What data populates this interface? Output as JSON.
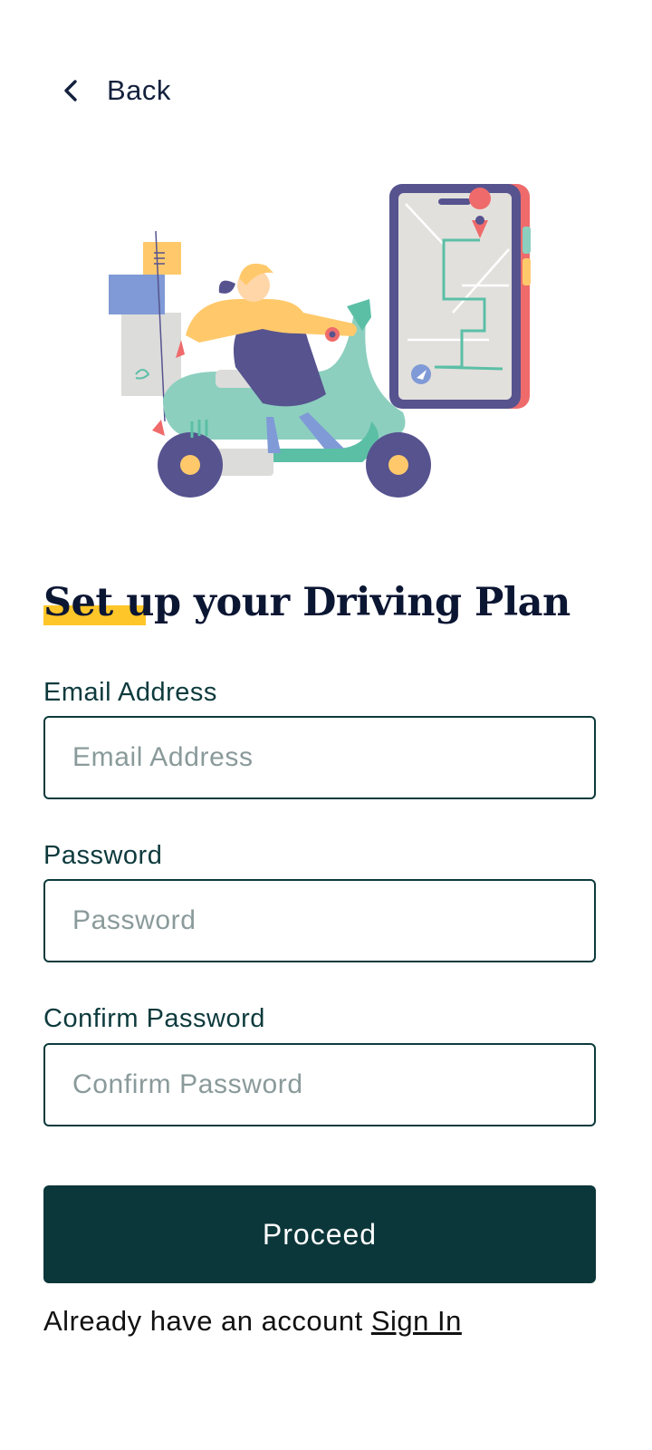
{
  "header": {
    "back_label": "Back",
    "back_icon": "chevron-left-icon"
  },
  "illustration": {
    "subject": "delivery-scooter-map-illustration"
  },
  "title": "Set up your Driving Plan",
  "form": {
    "email": {
      "label": "Email Address",
      "placeholder": "Email Address",
      "value": ""
    },
    "password": {
      "label": "Password",
      "placeholder": "Password",
      "value": ""
    },
    "confirm_password": {
      "label": "Confirm Password",
      "placeholder": "Confirm Password",
      "value": ""
    },
    "proceed_label": "Proceed"
  },
  "footer": {
    "prompt": "Already have an account",
    "signin_label": "Sign In"
  },
  "colors": {
    "primary": "#0c373a",
    "title": "#0b1633",
    "highlight": "#ffc629"
  }
}
